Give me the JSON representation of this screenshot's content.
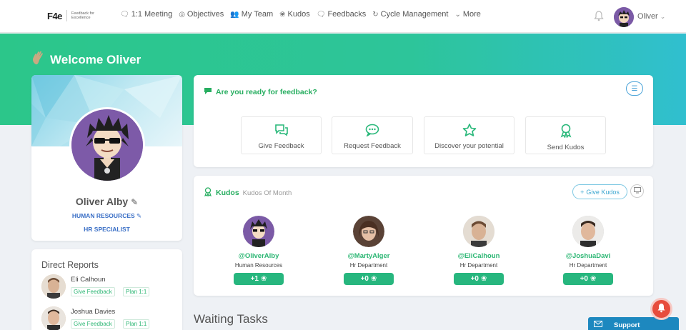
{
  "logo": {
    "mark": "F4e",
    "tagline": "Feedback for Excellence"
  },
  "nav": {
    "items": [
      {
        "icon": "chat-icon",
        "glyph": "🗨",
        "label": "1:1 Meeting"
      },
      {
        "icon": "target-icon",
        "glyph": "◎",
        "label": "Objectives"
      },
      {
        "icon": "team-icon",
        "glyph": "👥",
        "label": "My Team"
      },
      {
        "icon": "award-icon",
        "glyph": "❀",
        "label": "Kudos"
      },
      {
        "icon": "comment-icon",
        "glyph": "🗨",
        "label": "Feedbacks"
      },
      {
        "icon": "cycle-icon",
        "glyph": "↻",
        "label": "Cycle Management"
      },
      {
        "icon": "chevron-down-icon",
        "glyph": "⌄",
        "label": "More"
      }
    ],
    "user_name": "Oliver",
    "user_caret": "⌄"
  },
  "welcome": {
    "text": "Welcome Oliver"
  },
  "profile": {
    "name": "Oliver Alby",
    "department": "HUMAN RESOURCES",
    "role": "HR SPECIALIST"
  },
  "reports": {
    "title": "Direct Reports",
    "items": [
      {
        "name": "Eli Calhoun",
        "give": "Give Feedback",
        "plan": "Plan 1:1"
      },
      {
        "name": "Joshua Davies",
        "give": "Give Feedback",
        "plan": "Plan 1:1"
      }
    ]
  },
  "feedback": {
    "title": "Are you ready for feedback?",
    "actions": [
      {
        "icon": "chat-bubbles-icon",
        "label": "Give Feedback"
      },
      {
        "icon": "comment-dots-icon",
        "label": "Request Feedback"
      },
      {
        "icon": "star-icon",
        "label": "Discover your potential"
      },
      {
        "icon": "award-icon",
        "label": "Send Kudos"
      }
    ]
  },
  "kudos": {
    "title": "Kudos",
    "subtitle": "Kudos Of Month",
    "give_label": "Give Kudos",
    "people": [
      {
        "handle": "@OliverAlby",
        "dept": "Human Resources",
        "count": "+1"
      },
      {
        "handle": "@MartyAlger",
        "dept": "Hr Department",
        "count": "+0"
      },
      {
        "handle": "@EliCalhoun",
        "dept": "Hr Department",
        "count": "+0"
      },
      {
        "handle": "@JoshuaDavi",
        "dept": "Hr Department",
        "count": "+0"
      }
    ]
  },
  "waiting": {
    "title": "Waiting Tasks"
  },
  "support": {
    "label": "Support"
  },
  "colors": {
    "brand_green": "#27b67e",
    "link_blue": "#3a6fc6",
    "support_blue": "#1d88bf",
    "alert_red": "#e74c3c"
  }
}
